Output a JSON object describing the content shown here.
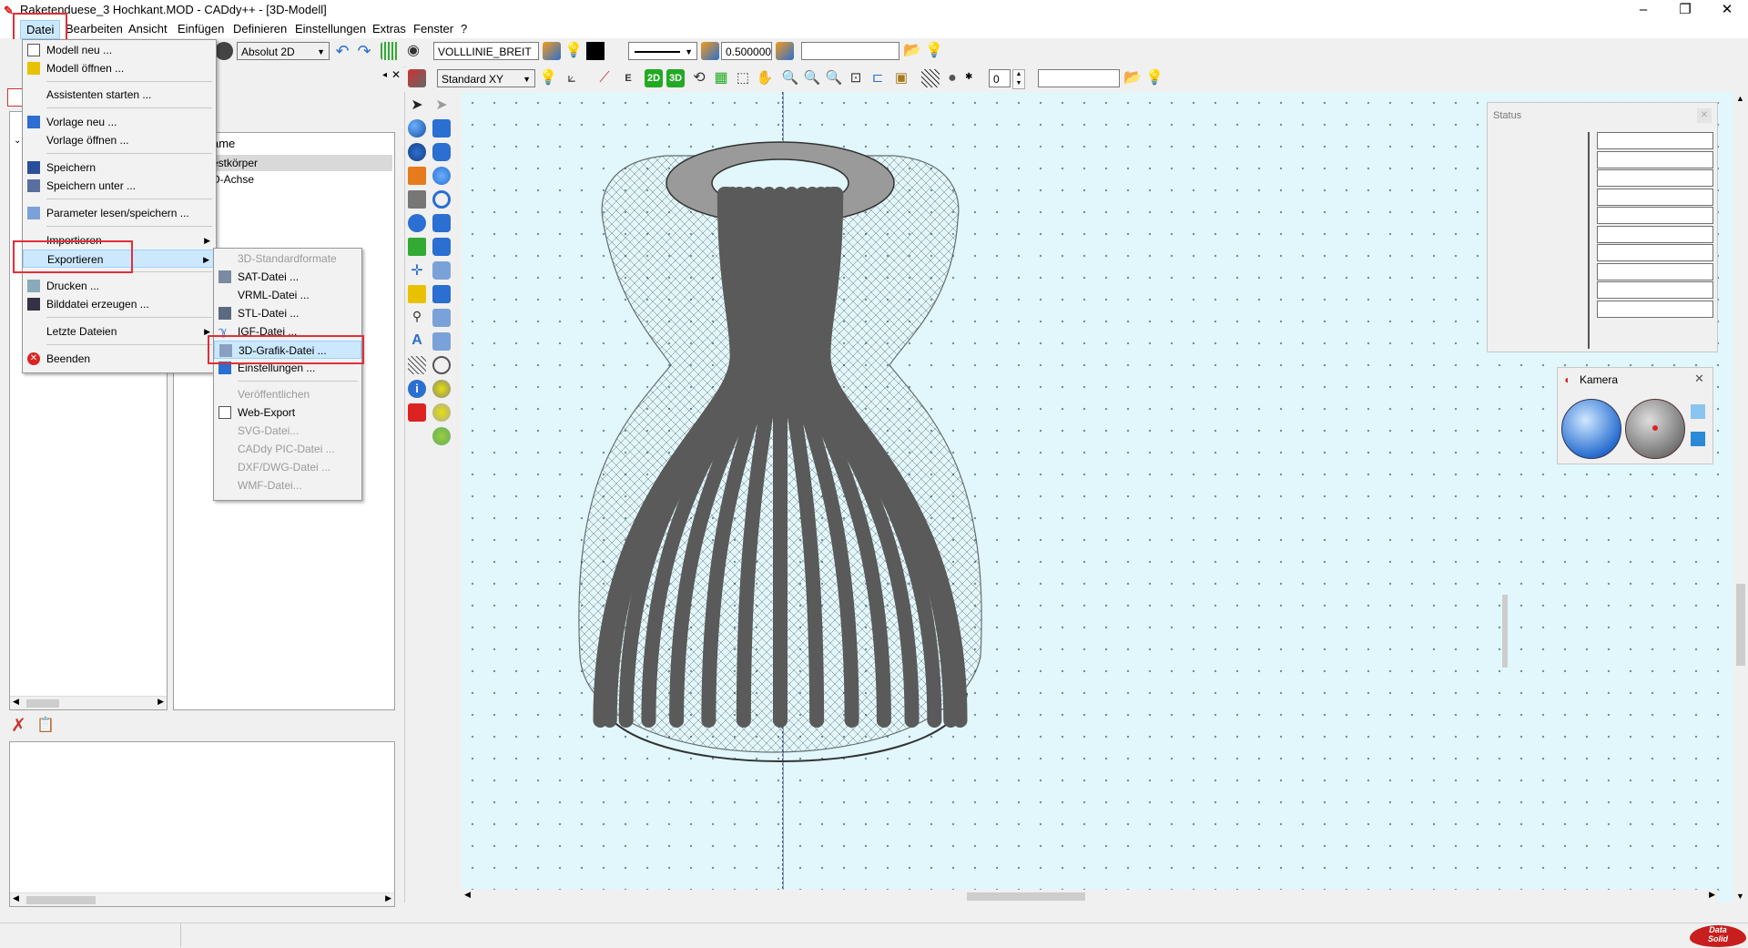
{
  "window": {
    "title": "Raketenduese_3 Hochkant.MOD - CADdy++ - [3D-Modell]",
    "controls": {
      "minimize": "–",
      "restore": "❐",
      "close": "✕"
    },
    "mdi_controls": {
      "minimize": "_",
      "restore": "❐",
      "close": "✕"
    }
  },
  "menubar": [
    "Datei",
    "Bearbeiten",
    "Ansicht",
    "Einfügen",
    "Definieren",
    "Einstellungen",
    "Extras",
    "Fenster",
    "?"
  ],
  "toolbar1": {
    "mode_select": "Absolut 2D",
    "linetype": "VOLLLINIE_BREIT",
    "line_width": "0.500000",
    "empty_field": ""
  },
  "toolbar2": {
    "view_select": "Standard XY",
    "btn_2d": "2D",
    "btn_3d": "3D",
    "spinner_value": "0",
    "empty_field": ""
  },
  "tree": {
    "header": "ame",
    "items": [
      "estkörper",
      "D-Achse"
    ]
  },
  "file_menu": {
    "items": [
      {
        "label": "Modell neu ...",
        "icon": "new-model-icon"
      },
      {
        "label": "Modell öffnen ...",
        "icon": "open-model-icon"
      },
      {
        "label": "Assistenten starten ...",
        "icon": ""
      },
      {
        "label": "Vorlage neu ...",
        "icon": "new-template-icon"
      },
      {
        "label": "Vorlage öffnen ...",
        "icon": ""
      },
      {
        "label": "Speichern",
        "icon": "save-icon"
      },
      {
        "label": "Speichern unter ...",
        "icon": "save-as-icon"
      },
      {
        "label": "Parameter lesen/speichern ...",
        "icon": "parameter-icon"
      },
      {
        "label": "Importieren",
        "icon": ""
      },
      {
        "label": "Exportieren",
        "icon": ""
      },
      {
        "label": "Drucken ...",
        "icon": "print-icon"
      },
      {
        "label": "Bilddatei erzeugen ...",
        "icon": "image-file-icon"
      },
      {
        "label": "Letzte Dateien",
        "icon": ""
      },
      {
        "label": "Beenden",
        "icon": "exit-icon"
      }
    ]
  },
  "export_submenu": {
    "items": [
      {
        "label": "3D-Standardformate",
        "enabled": false
      },
      {
        "label": "SAT-Datei ...",
        "enabled": true
      },
      {
        "label": "VRML-Datei ...",
        "enabled": true
      },
      {
        "label": "STL-Datei ...",
        "enabled": true
      },
      {
        "label": "IGF-Datei ...",
        "enabled": true
      },
      {
        "label": "3D-Grafik-Datei ...",
        "enabled": true
      },
      {
        "label": "Einstellungen ...",
        "enabled": true
      },
      {
        "label": "Veröffentlichen",
        "enabled": false
      },
      {
        "label": "Web-Export",
        "enabled": true
      },
      {
        "label": "SVG-Datei...",
        "enabled": false
      },
      {
        "label": "CADdy PIC-Datei ...",
        "enabled": false
      },
      {
        "label": "DXF/DWG-Datei ...",
        "enabled": false
      },
      {
        "label": "WMF-Datei...",
        "enabled": false
      }
    ]
  },
  "status_panel": {
    "title": "Status",
    "close": "✕"
  },
  "camera_panel": {
    "title": "Kamera",
    "close": "✕"
  },
  "brand": {
    "line1": "Data",
    "line2": "Solid"
  },
  "colors": {
    "highlight": "#cce8ff",
    "annotation": "#e0303a",
    "viewport": "#e1f7fb",
    "model": "#5a5a5a"
  }
}
